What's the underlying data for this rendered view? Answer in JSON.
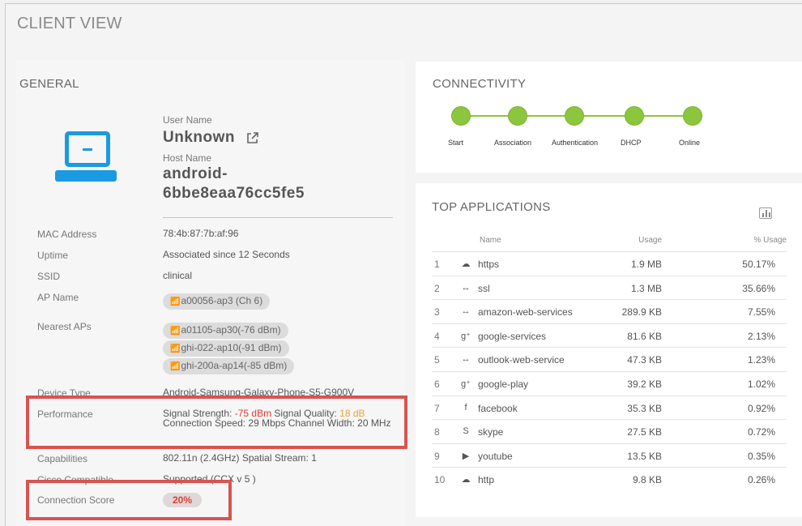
{
  "page_title": "CLIENT VIEW",
  "general": {
    "title": "GENERAL",
    "user_name_label": "User Name",
    "user_name": "Unknown",
    "host_name_label": "Host Name",
    "host_name_line1": "android-",
    "host_name_line2": "6bbe8eaa76cc5fe5",
    "mac_label": "MAC Address",
    "mac_value": "78:4b:87:7b:af:96",
    "uptime_label": "Uptime",
    "uptime_value": "Associated since 12 Seconds",
    "ssid_label": "SSID",
    "ssid_value": "clinical",
    "ap_name_label": "AP Name",
    "ap_name_value": "a00056-ap3 (Ch 6)",
    "nearest_label": "Nearest APs",
    "nearest_aps": [
      "a01105-ap30(-76 dBm)",
      "ghi-022-ap10(-91 dBm)",
      "ghi-200a-ap14(-85 dBm)"
    ],
    "device_type_label": "Device Type",
    "device_type_value": "Android-Samsung-Galaxy-Phone-S5-G900V",
    "performance_label": "Performance",
    "perf_signal_strength_label": "Signal Strength: ",
    "perf_signal_strength_value": "-75 dBm",
    "perf_signal_quality_label": " Signal Quality: ",
    "perf_signal_quality_value": "18 dB",
    "perf_rest": " Connection Speed: 29 Mbps Channel Width: 20 MHz",
    "capabilities_label": "Capabilities",
    "capabilities_value": "802.11n (2.4GHz) Spatial Stream: 1",
    "cisco_label": "Cisco Compatible",
    "cisco_value": "Supported (CCX v 5 )",
    "score_label": "Connection Score",
    "score_value": "20%"
  },
  "connectivity": {
    "title": "CONNECTIVITY",
    "steps": [
      "Start",
      "Association",
      "Authentication",
      "DHCP",
      "Online"
    ],
    "color": "#8cc63f"
  },
  "top_apps": {
    "title": "TOP APPLICATIONS",
    "columns": [
      "Name",
      "Usage",
      "% Usage"
    ],
    "rows": [
      {
        "n": "1",
        "icon": "cloud-icon",
        "name": "https",
        "usage": "1.9 MB",
        "pct": "50.17%"
      },
      {
        "n": "2",
        "icon": "arrows-icon",
        "name": "ssl",
        "usage": "1.3 MB",
        "pct": "35.66%"
      },
      {
        "n": "3",
        "icon": "arrows-icon",
        "name": "amazon-web-services",
        "usage": "289.9 KB",
        "pct": "7.55%"
      },
      {
        "n": "4",
        "icon": "google-plus-icon",
        "name": "google-services",
        "usage": "81.6 KB",
        "pct": "2.13%"
      },
      {
        "n": "5",
        "icon": "arrows-icon",
        "name": "outlook-web-service",
        "usage": "47.3 KB",
        "pct": "1.23%"
      },
      {
        "n": "6",
        "icon": "google-plus-icon",
        "name": "google-play",
        "usage": "39.2 KB",
        "pct": "1.02%"
      },
      {
        "n": "7",
        "icon": "facebook-icon",
        "name": "facebook",
        "usage": "35.3 KB",
        "pct": "0.92%"
      },
      {
        "n": "8",
        "icon": "skype-icon",
        "name": "skype",
        "usage": "27.5 KB",
        "pct": "0.72%"
      },
      {
        "n": "9",
        "icon": "youtube-icon",
        "name": "youtube",
        "usage": "13.5 KB",
        "pct": "0.35%"
      },
      {
        "n": "10",
        "icon": "cloud-icon",
        "name": "http",
        "usage": "9.8 KB",
        "pct": "0.26%"
      }
    ]
  },
  "colors": {
    "accent": "#1a9ae0",
    "highlight": "#d9534f",
    "bad": "#e03c31",
    "warn": "#e6a23c"
  }
}
